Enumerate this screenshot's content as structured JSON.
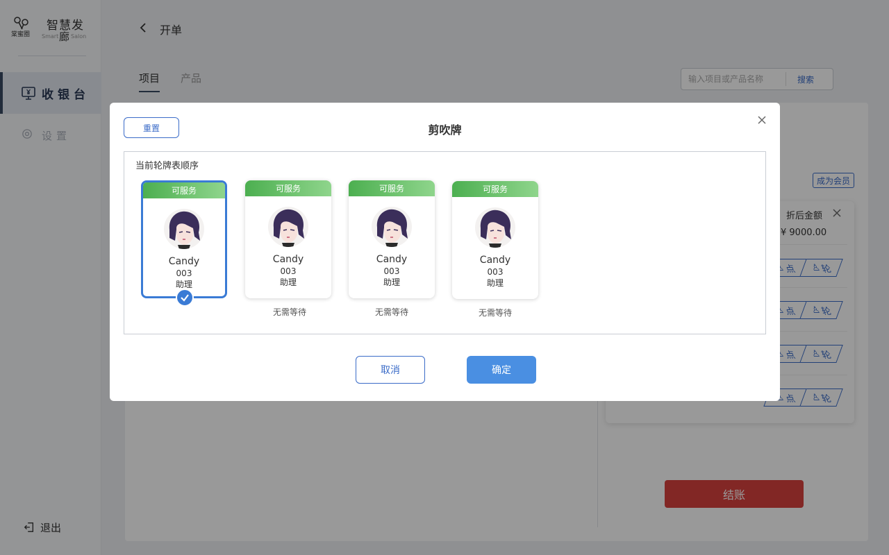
{
  "sidebar": {
    "logo": {
      "mark_text": "棠蜜圈",
      "title": "智慧发",
      "sub_left": "Smart",
      "sub_center": "廊",
      "sub_right": "Salon"
    },
    "nav": {
      "cashier": "收银台",
      "settings": "设置"
    },
    "logout": "退出",
    "icons": {
      "cashier": "monitor-yen-icon",
      "settings": "gear-icon",
      "logout": "logout-icon"
    }
  },
  "header": {
    "title": "开单",
    "back_icon": "chevron-left-icon"
  },
  "tabs": {
    "items": "项目",
    "products": "产品"
  },
  "search": {
    "placeholder": "输入项目或产品名称",
    "button": "搜索"
  },
  "order": {
    "member_button": "成为会员",
    "discount_label": "折后金额",
    "amount": "¥ 9000.00",
    "pills": [
      {
        "a": "点",
        "b": "轮"
      },
      {
        "a": "点",
        "b": "轮"
      },
      {
        "a": "点",
        "b": "轮"
      },
      {
        "a": "点",
        "b": "轮"
      }
    ],
    "checkout": "结账"
  },
  "modal": {
    "title": "剪吹牌",
    "reset": "重置",
    "section_label": "当前轮牌表顺序",
    "cards": [
      {
        "status": "可服务",
        "name": "Candy",
        "code": "003",
        "role": "助理",
        "wait": "",
        "selected": true
      },
      {
        "status": "可服务",
        "name": "Candy",
        "code": "003",
        "role": "助理",
        "wait": "无需等待",
        "selected": false
      },
      {
        "status": "可服务",
        "name": "Candy",
        "code": "003",
        "role": "助理",
        "wait": "无需等待",
        "selected": false
      },
      {
        "status": "可服务",
        "name": "Candy",
        "code": "003",
        "role": "助理",
        "wait": "无需等待",
        "selected": false
      }
    ],
    "cancel": "取消",
    "confirm": "确定"
  },
  "colors": {
    "accent": "#3a6bc8",
    "primary_button": "#4a8fe2",
    "status_green": "#4caf50",
    "checkout_red": "#d9413e",
    "nav_dark": "#3a4a63"
  }
}
